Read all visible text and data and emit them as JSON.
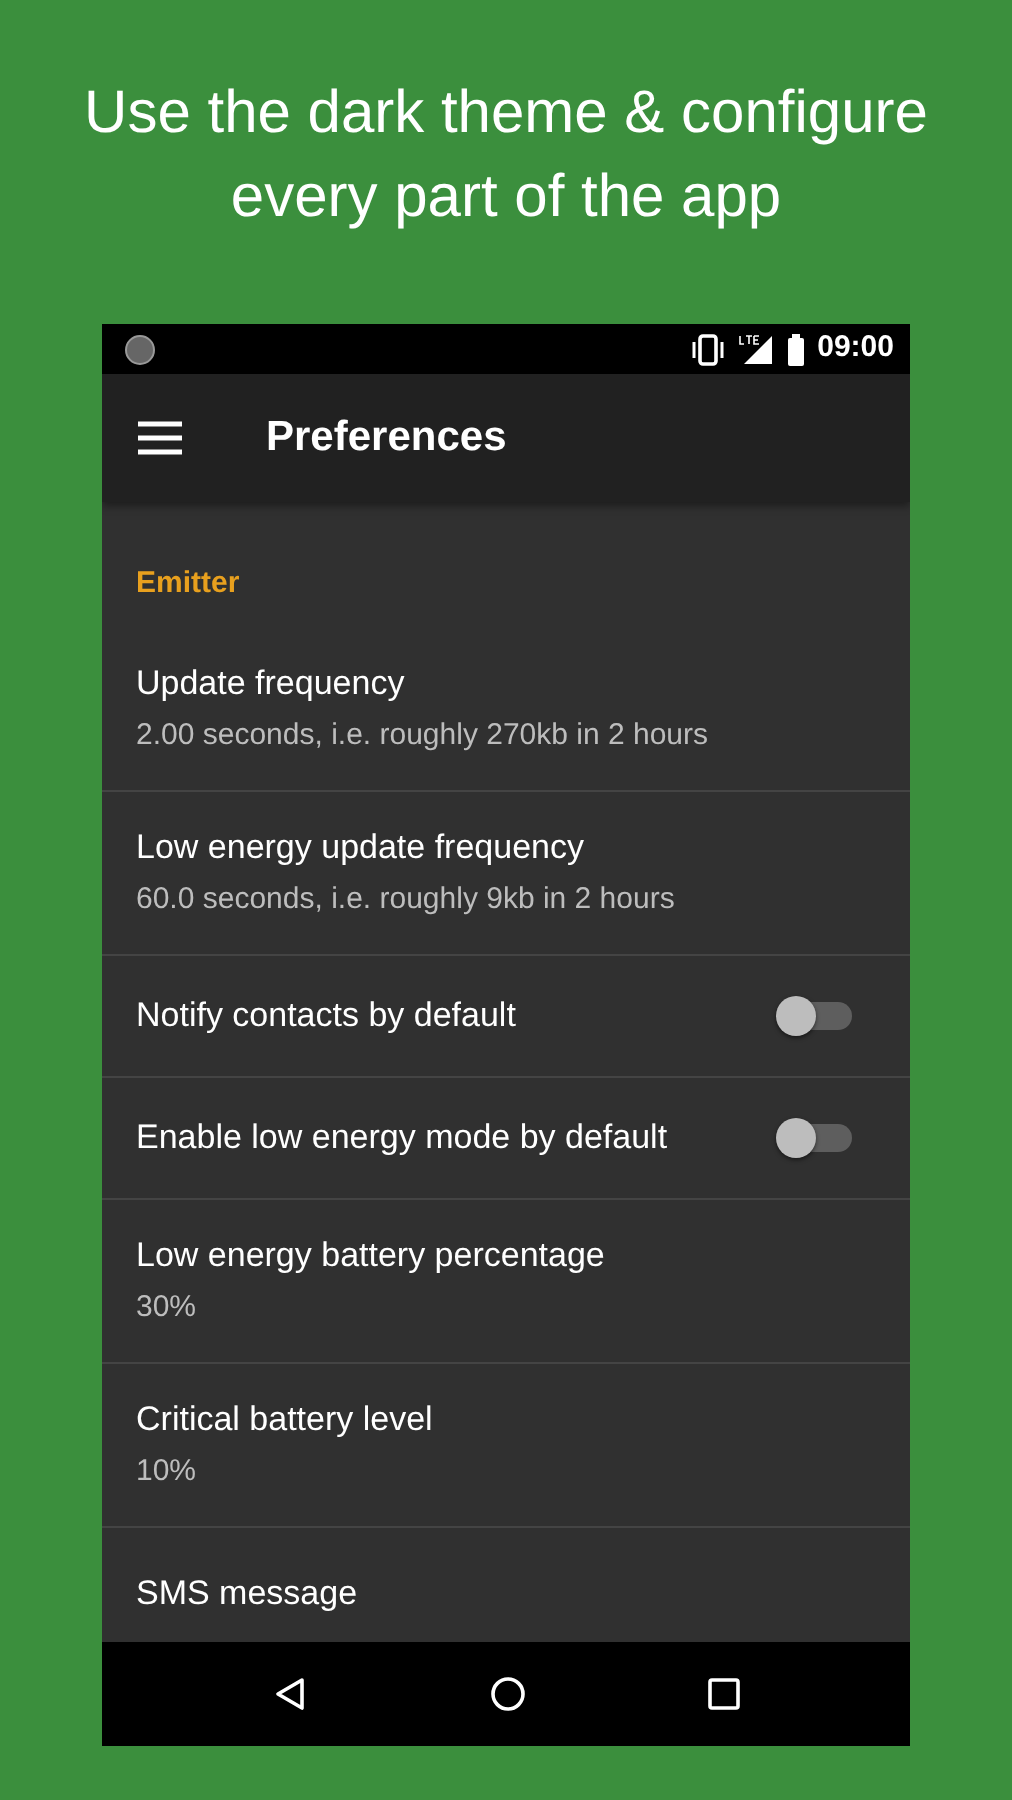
{
  "headline": "Use the dark theme & configure every part of the app",
  "status_bar": {
    "time": "09:00"
  },
  "toolbar": {
    "title": "Preferences"
  },
  "category": {
    "title": "Emitter"
  },
  "preferences": [
    {
      "kind": "text",
      "title": "Update frequency",
      "summary": "2.00 seconds, i.e. roughly 270kb in 2 hours"
    },
    {
      "kind": "text",
      "title": "Low energy update frequency",
      "summary": "60.0 seconds, i.e. roughly 9kb in 2 hours"
    },
    {
      "kind": "switch",
      "title": "Notify contacts by default",
      "checked": false
    },
    {
      "kind": "switch",
      "title": "Enable low energy mode by default",
      "checked": false
    },
    {
      "kind": "text",
      "title": "Low energy battery percentage",
      "summary": "30%"
    },
    {
      "kind": "text",
      "title": "Critical battery level",
      "summary": "10%"
    },
    {
      "kind": "text",
      "title": "SMS message"
    }
  ]
}
